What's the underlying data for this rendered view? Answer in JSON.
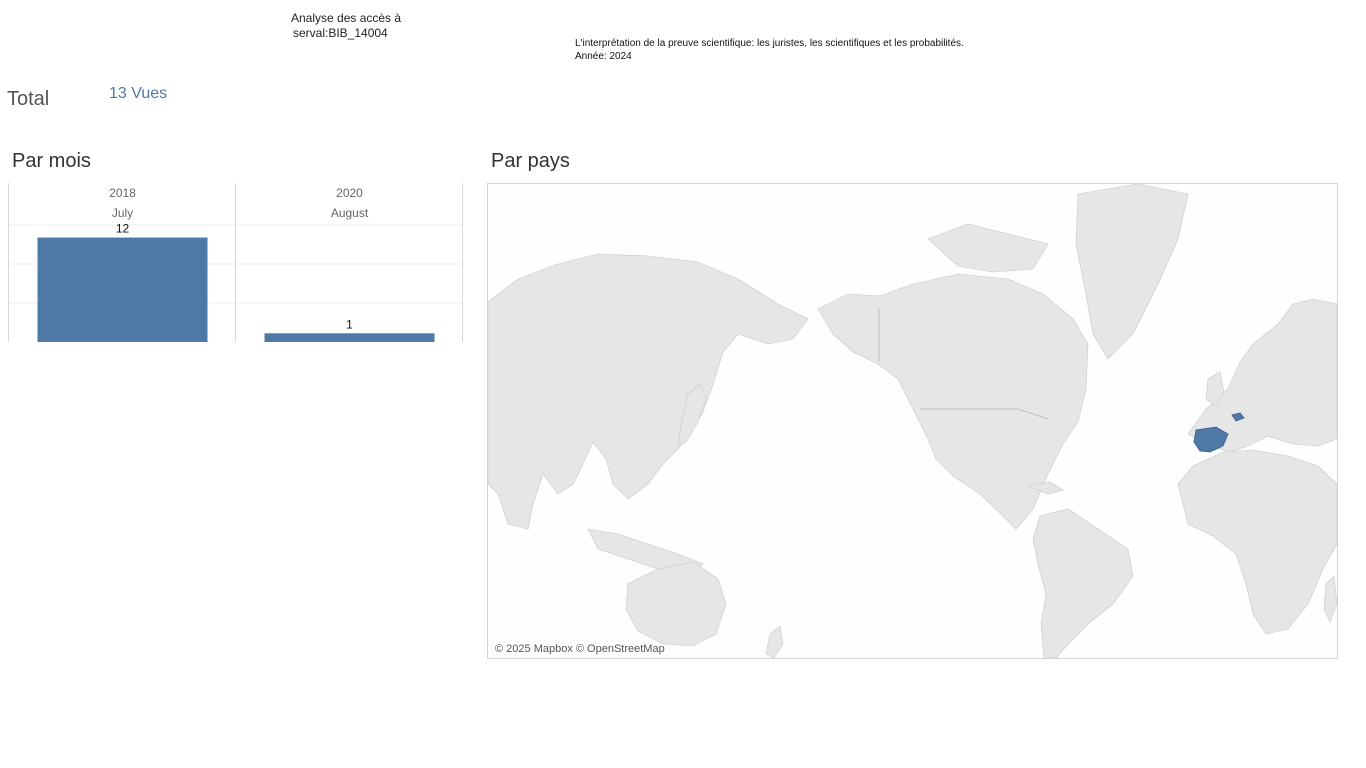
{
  "header": {
    "analysis_line1": "Analyse des accès à",
    "analysis_line2": "serval:BIB_14004",
    "doc_title": "L'interprétation de la preuve scientifique: les juristes, les scientifiques et les probabilités.",
    "doc_year": "Année: 2024"
  },
  "total": {
    "label": "Total",
    "value": "13 Vues"
  },
  "sections": {
    "by_month": "Par mois",
    "by_country": "Par pays"
  },
  "chart_data": {
    "type": "bar",
    "categories": [
      {
        "year": "2018",
        "month": "July"
      },
      {
        "year": "2020",
        "month": "August"
      }
    ],
    "values": [
      12,
      1
    ],
    "color": "#4e79a7",
    "grid": true
  },
  "map": {
    "attribution": "© 2025 Mapbox © OpenStreetMap",
    "highlighted_countries": [
      "Spain",
      "Switzerland"
    ],
    "highlight_color": "#4e79a7",
    "land_color": "#e6e6e6",
    "water_color": "#fefefe"
  }
}
